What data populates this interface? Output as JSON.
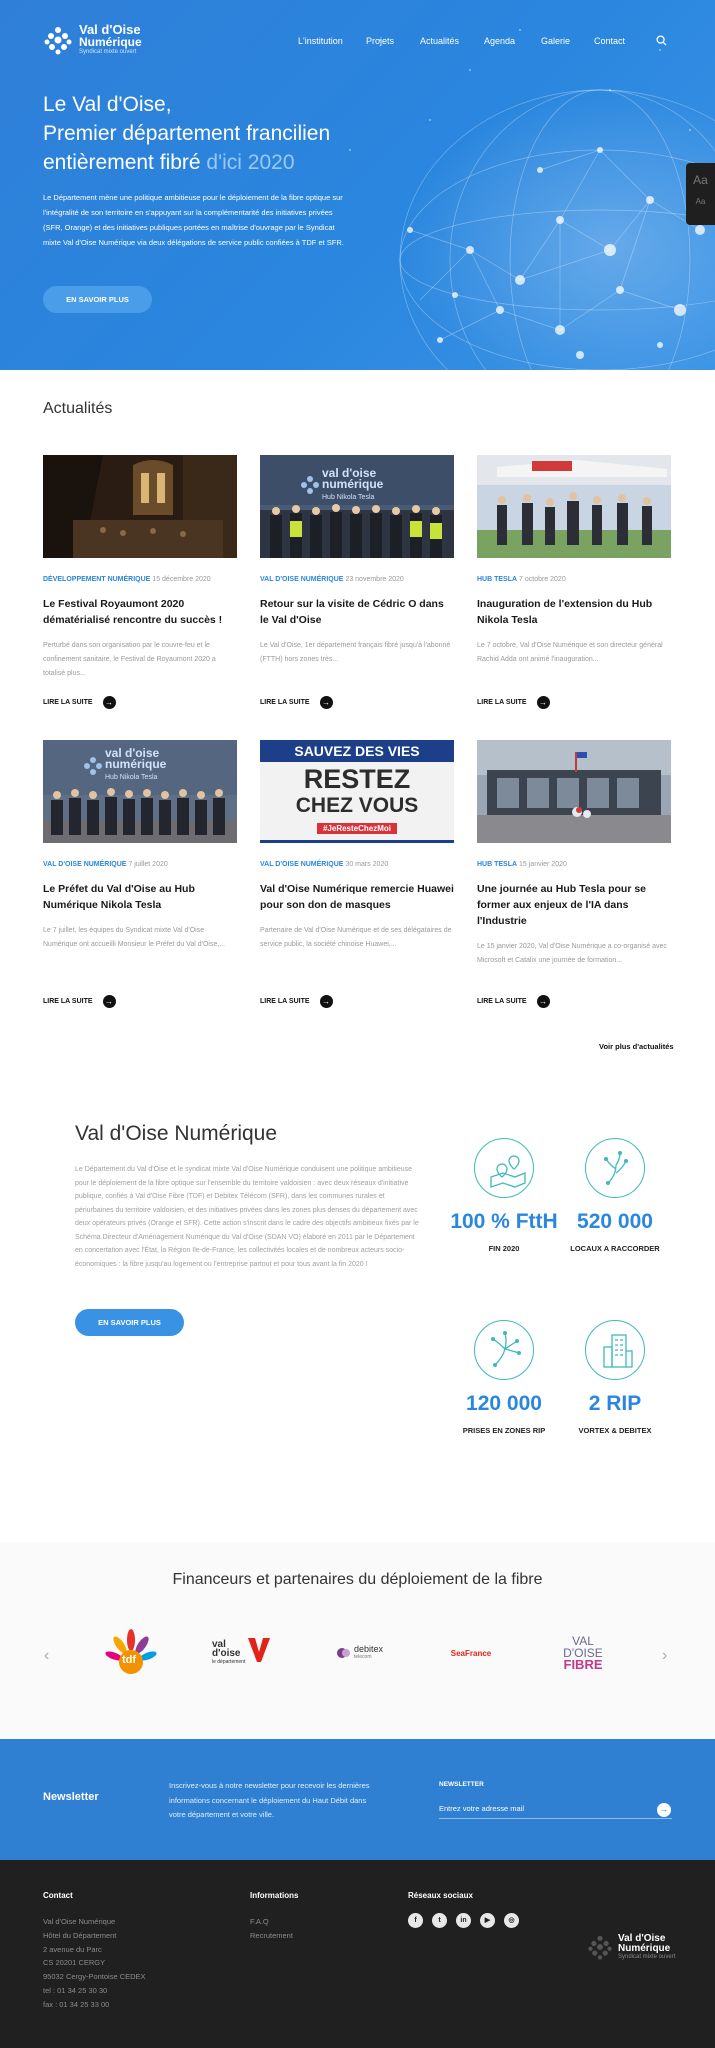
{
  "header": {
    "logo": {
      "line1": "Val d'Oise",
      "line2": "Numérique",
      "tagline": "Syndicat mixte ouvert"
    },
    "nav": [
      "L'institution",
      "Projets",
      "Actualités",
      "Agenda",
      "Galerie",
      "Contact"
    ]
  },
  "hero": {
    "title_line1": "Le Val d'Oise,",
    "title_line2": "Premier département francilien",
    "title_line3_a": "entièrement fibré ",
    "title_line3_b": "d'ici 2020",
    "lead": "Le Département mène une politique ambitieuse pour le déploiement de la fibre optique sur l'intégralité de son territoire en s'appuyant sur la complémentarité des initiatives privées (SFR, Orange) et des initiatives publiques portées en maîtrise d'ouvrage par le Syndicat  mixte Val d'Oise Numérique via deux délégations de service public confiées à TDF et SFR.",
    "cta": "EN SAVOIR PLUS"
  },
  "accessibility": {
    "large": "Aa",
    "small": "Aa"
  },
  "news": {
    "title": "Actualités",
    "read_more": "LIRE LA SUITE",
    "more_link": "Voir plus d'actualités",
    "items": [
      {
        "cat": "DÉVELOPPEMENT NUMÉRIQUE",
        "date": "15 décembre 2020",
        "title": "Le Festival Royaumont 2020 dématérialisé rencontre du succès !",
        "excerpt": "Perturbé dans son organisation par le couvre-feu et le confinement sanitaire, le Festival de Royaumont 2020 a totalisé plus..."
      },
      {
        "cat": "VAL D'OISE NUMÉRIQUE",
        "date": "23 novembre 2020",
        "title": "Retour sur la visite de Cédric O dans le Val d'Oise",
        "excerpt": "Le  Val d'Oise, 1er département français fibré jusqu'à l'abonné (FTTH) hors zones très..."
      },
      {
        "cat": "HUB TESLA",
        "date": "7 octobre 2020",
        "title": "Inauguration de l'extension du Hub Nikola Tesla",
        "excerpt": "Le 7 octobre, Val d'Oise Numérique et son directeur général Rachid Adda ont animé l'inauguration..."
      },
      {
        "cat": "VAL D'OISE NUMÉRIQUE",
        "date": "7 juillet 2020",
        "title": "Le Préfet du Val d'Oise au Hub Numérique Nikola Tesla",
        "excerpt": "Le 7 juillet, les équipes du Syndicat mixte Val d'Oise Numérique ont accueilli Monsieur le Préfet du Val d'Oise,..."
      },
      {
        "cat": "VAL D'OISE NUMÉRIQUE",
        "date": "30 mars 2020",
        "title": "Val d'Oise Numérique remercie Huawei pour son don de masques",
        "excerpt": "Partenaire de Val d'Oise Numérique et de ses délégataires de service public, la société chinoise Huawei,..."
      },
      {
        "cat": "HUB TESLA",
        "date": "15 janvier 2020",
        "title": "Une journée au Hub Tesla pour se former aux enjeux de l'IA dans l'Industrie",
        "excerpt": "Le 15 janvier 2020, Val d'Oise Numérique a co-organisé avec Microsoft et Catalix une journée de formation..."
      }
    ],
    "img2_text": {
      "line1": "val d'oise",
      "line2": "numérique",
      "line3": "Hub Nikola Tesla"
    },
    "img5_text": {
      "line1": "SAUVEZ DES VIES",
      "line2": "RESTEZ",
      "line3": "CHEZ VOUS",
      "line4": "#JeResteChezMoi"
    }
  },
  "about": {
    "title": "Val d'Oise Numérique",
    "text": "Le Département du Val d'Oise et le syndicat mixte Val d'Oise Numérique conduisent une politique ambitieuse pour le déploiement de la fibre optique sur l'ensemble du territoire valdoisien : avec deux réseaux d'initiative publique, confiés à Val d'Oise Fibre (TDF) et Debitex Télécom (SFR), dans les communes rurales et périurbaines du territoire valdoisien, et des initiatives privées dans les zones plus denses du département avec deux opérateurs privés (Orange et SFR). Cette action s'inscrit dans le cadre des objectifs ambitieux fixés par le Schéma Directeur d'Aménagement Numérique du Val d'Oise (SDAN VO) élaboré en 2011 par le Département en concertation avec l'État, la Région Ile-de-France, les collectivités locales et de nombreux acteurs socio-économiques : la fibre jusqu'au logement ou l'entreprise partout et pour tous avant la fin 2020 !",
    "cta": "EN SAVOIR PLUS",
    "stats": [
      {
        "value": "100 % FttH",
        "label": "FIN 2020",
        "icon": "map-pins-icon"
      },
      {
        "value": "520 000",
        "label": "LOCAUX A RACCORDER",
        "icon": "fiber-tree-icon"
      },
      {
        "value": "120 000",
        "label": "PRISES EN ZONES RIP",
        "icon": "fiber-network-icon"
      },
      {
        "value": "2 RIP",
        "label": "VORTEX & DEBITEX",
        "icon": "buildings-icon"
      }
    ]
  },
  "partners": {
    "title": "Financeurs et partenaires du déploiement de la fibre",
    "logos": {
      "tdf": "tdf",
      "vdo_a": "val",
      "vdo_b": "d'oise",
      "vdo_c": "le département",
      "debitex": "debitex",
      "debitex_sub": "telecom",
      "seafrance": "SeaFrance",
      "fibre_a": "VAL",
      "fibre_b": "D'OISE",
      "fibre_c": "FIBRE"
    }
  },
  "newsletter": {
    "title": "Newsletter",
    "text": "Inscrivez-vous à notre newsletter pour recevoir les dernières informations concernant le déploiement du Haut Débit dans votre département et votre ville.",
    "label": "NEWSLETTER",
    "placeholder": "Entrez votre adresse mail"
  },
  "footer": {
    "contact_title": "Contact",
    "contact_lines": [
      "Val d'Oise Numérique",
      "Hôtel du Département",
      "2 avenue du Parc",
      "CS 20201 CERGY",
      "95032 Cergy-Pontoise CEDEX",
      "tel : 01 34 25 30 30",
      "fax : 01 34 25 33 00"
    ],
    "info_title": "Informations",
    "info_links": [
      "F.A.Q",
      "Recrutement"
    ],
    "social_title": "Réseaux sociaux",
    "socials": [
      "f",
      "t",
      "in",
      "▶",
      "◎"
    ],
    "logo": {
      "line1": "Val d'Oise",
      "line2": "Numérique",
      "tagline": "Syndicat mixte ouvert"
    }
  }
}
